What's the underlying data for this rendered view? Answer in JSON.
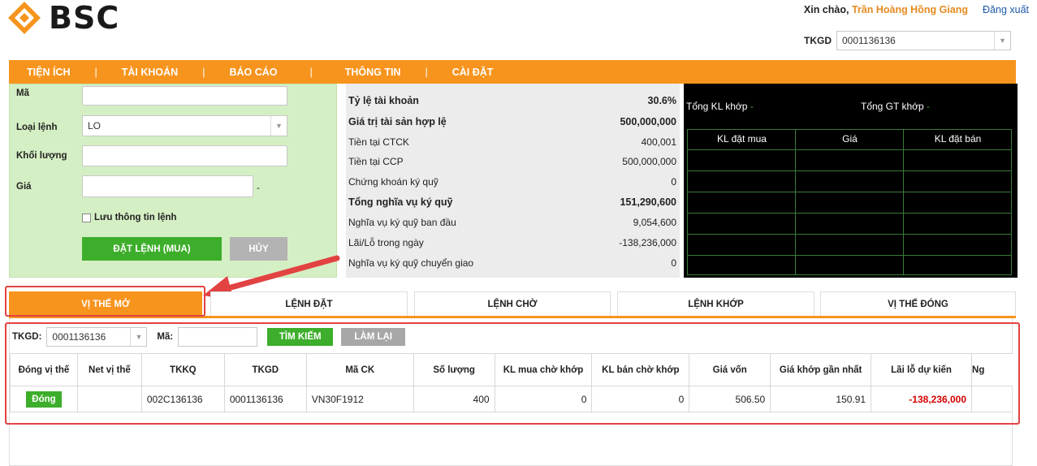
{
  "brand": {
    "logo_text": "BSC",
    "accent": "#f7941d",
    "green": "#3dae2b"
  },
  "header": {
    "greeting": "Xin chào,",
    "user_name": "Trần Hoàng Hồng Giang",
    "logout": "Đăng xuất",
    "tkgd_label": "TKGD",
    "tkgd_value": "0001136136"
  },
  "nav": [
    "TIỆN ÍCH",
    "TÀI KHOẢN",
    "BÁO CÁO",
    "THÔNG TIN",
    "CÀI ĐẶT"
  ],
  "nav_sep": "|",
  "order": {
    "ma_label": "Mã",
    "ma_value": "",
    "loai_label": "Loại lệnh",
    "loai_value": "LO",
    "kl_label": "Khối lượng",
    "kl_value": "",
    "gia_label": "Giá",
    "gia_value": "",
    "gia_suffix": "-",
    "save_label": "Lưu thông tin lệnh",
    "submit_label": "ĐẶT LỆNH (MUA)",
    "cancel_label": "HỦY"
  },
  "account": [
    {
      "label": "Tỷ lệ tài khoản",
      "value": "30.6%",
      "bold": true
    },
    {
      "label": "Giá trị tài sản hợp lệ",
      "value": "500,000,000",
      "bold": true
    },
    {
      "label": "Tiền tại CTCK",
      "value": "400,001",
      "bold": false
    },
    {
      "label": "Tiền tại CCP",
      "value": "500,000,000",
      "bold": false
    },
    {
      "label": "Chứng khoán ký quỹ",
      "value": "0",
      "bold": false
    },
    {
      "label": "Tổng nghĩa vụ ký quỹ",
      "value": "151,290,600",
      "bold": true
    },
    {
      "label": "Nghĩa vụ ký quỹ ban đầu",
      "value": "9,054,600",
      "bold": false
    },
    {
      "label": "Lãi/Lỗ trong ngày",
      "value": "-138,236,000",
      "bold": false
    },
    {
      "label": "Nghĩa vụ ký quỹ chuyển giao",
      "value": "0",
      "bold": false
    }
  ],
  "market": {
    "total_vol_label": "Tổng KL khớp",
    "total_vol_value": "-",
    "total_val_label": "Tổng GT khớp",
    "total_val_value": "-",
    "col_buy": "KL đặt mua",
    "col_price": "Giá",
    "col_sell": "KL đặt bán"
  },
  "tabs": [
    "VỊ THẾ MỞ",
    "LỆNH ĐẶT",
    "LỆNH CHỜ",
    "LỆNH KHỚP",
    "VỊ THẾ ĐÓNG"
  ],
  "filter": {
    "tkgd_label": "TKGD:",
    "tkgd_value": "0001136136",
    "ma_label": "Mã:",
    "ma_value": "",
    "search_label": "TÌM KIẾM",
    "reset_label": "LÀM LẠI"
  },
  "table": {
    "headers": [
      "Đóng vị thế",
      "Net vị thế",
      "TKKQ",
      "TKGD",
      "Mã CK",
      "Số lượng",
      "KL mua chờ khớp",
      "KL bán chờ khớp",
      "Giá vốn",
      "Giá khớp gần nhất",
      "Lãi lỗ dự kiến",
      "Ng"
    ],
    "rows": [
      {
        "close_btn": "Đóng",
        "net": "",
        "tkkq": "002C136136",
        "tkgd": "0001136136",
        "ma_ck": "VN30F1912",
        "so_luong": "400",
        "kl_mua": "0",
        "kl_ban": "0",
        "gia_von": "506.50",
        "gia_khop": "150.91",
        "lai_lo": "-138,236,000",
        "ng": ""
      }
    ]
  }
}
